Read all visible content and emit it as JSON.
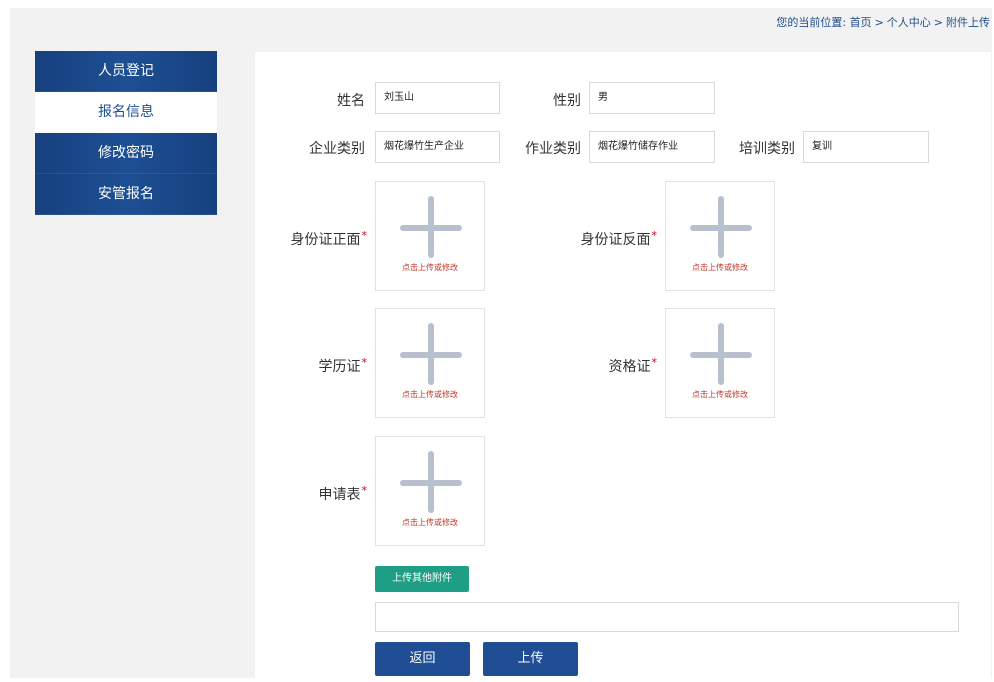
{
  "breadcrumb": {
    "prefix": "您的当前位置:",
    "items": [
      "首页",
      "个人中心",
      "附件上传"
    ],
    "separator": ">"
  },
  "sidebar": {
    "items": [
      {
        "label": "人员登记",
        "active": false
      },
      {
        "label": "报名信息",
        "active": true
      },
      {
        "label": "修改密码",
        "active": false
      },
      {
        "label": "安管报名",
        "active": false
      }
    ]
  },
  "form": {
    "name_label": "姓名",
    "name_value": "刘玉山",
    "gender_label": "性别",
    "gender_value": "男",
    "company_type_label": "企业类别",
    "company_type_value": "烟花爆竹生产企业",
    "work_type_label": "作业类别",
    "work_type_value": "烟花爆竹储存作业",
    "training_type_label": "培训类别",
    "training_type_value": "复训",
    "required_mark": "*"
  },
  "uploads": {
    "hint": "点击上传或修改",
    "id_front_label": "身份证正面",
    "id_back_label": "身份证反面",
    "education_label": "学历证",
    "qualification_label": "资格证",
    "application_label": "申请表"
  },
  "actions": {
    "upload_other_label": "上传其他附件",
    "back_label": "返回",
    "upload_label": "上传"
  },
  "colors": {
    "sidebar_blue": "#1d4f94",
    "button_blue": "#1f4e94",
    "button_green": "#1e9e85",
    "required_red": "#d0021b"
  }
}
